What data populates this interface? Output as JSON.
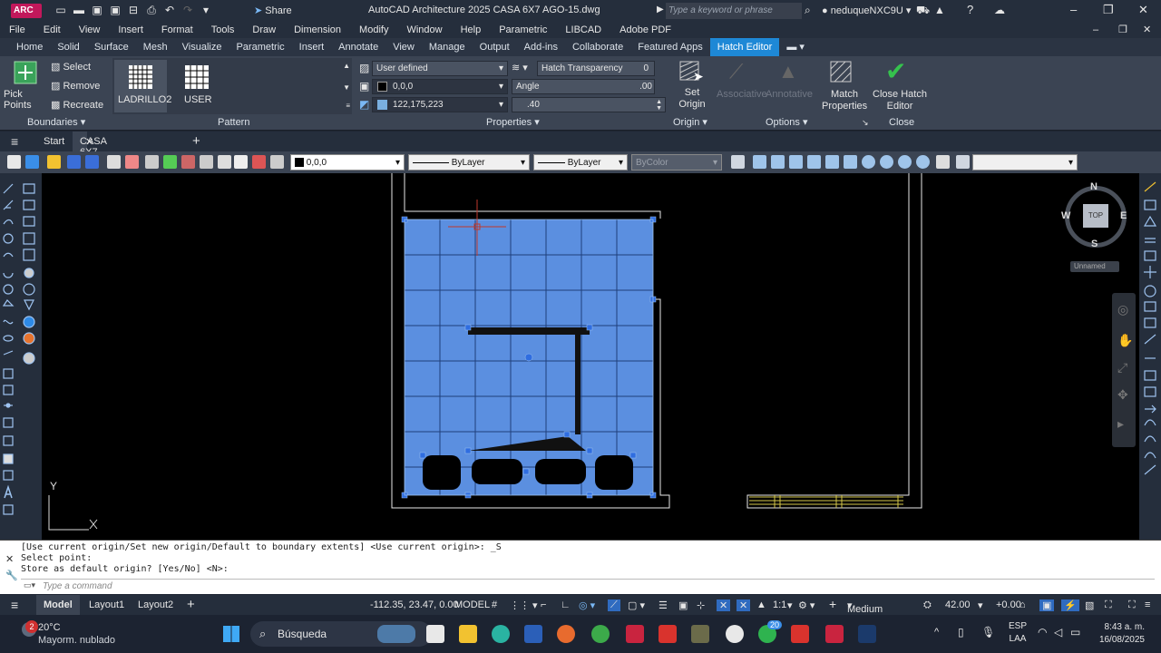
{
  "titlebar": {
    "app_logo": "ARC",
    "share_label": "Share",
    "window_title": "AutoCAD Architecture 2025   CASA 6X7 AGO-15.dwg",
    "search_placeholder": "Type a keyword or phrase",
    "username": "neduqueNXC9U"
  },
  "menubar": [
    "File",
    "Edit",
    "View",
    "Insert",
    "Format",
    "Tools",
    "Draw",
    "Dimension",
    "Modify",
    "Window",
    "Help",
    "Parametric",
    "LIBCAD",
    "Adobe PDF"
  ],
  "ribbon_tabs": [
    "Home",
    "Solid",
    "Surface",
    "Mesh",
    "Visualize",
    "Parametric",
    "Insert",
    "Annotate",
    "View",
    "Manage",
    "Output",
    "Add-ins",
    "Collaborate",
    "Featured Apps",
    "Hatch Editor"
  ],
  "ribbon": {
    "boundaries": {
      "pick_points": "Pick Points",
      "select": "Select",
      "remove": "Remove",
      "recreate": "Recreate",
      "panel_label": "Boundaries"
    },
    "pattern": {
      "items": [
        "LADRILLO2",
        "USER"
      ],
      "panel_label": "Pattern"
    },
    "properties": {
      "type": "User defined",
      "color": "0,0,0",
      "bg_color": "122,175,223",
      "transparency_label": "Hatch Transparency",
      "transparency_value": "0",
      "angle_label": "Angle",
      "angle_value": ".00",
      "scale_value": ".40",
      "panel_label": "Properties"
    },
    "origin": {
      "set_origin": "Set Origin",
      "panel_label": "Origin"
    },
    "options": {
      "associative": "Associative",
      "annotative": "Annotative",
      "match_properties": "Match Properties",
      "panel_label": "Options"
    },
    "close": {
      "close_label": "Close Hatch Editor",
      "panel_label": "Close"
    }
  },
  "filetabs": {
    "start": "Start",
    "active_file": "CASA 6X7 AGO-15*"
  },
  "prop_toolbar": {
    "color": "0,0,0",
    "linetype": "ByLayer",
    "lineweight": "ByLayer",
    "plotstyle": "ByColor"
  },
  "viewcube": {
    "north": "N",
    "south": "S",
    "east": "E",
    "west": "W",
    "face": "TOP",
    "ucs_name": "Unnamed"
  },
  "ucs": {
    "y_label": "Y",
    "x_label": "X"
  },
  "command": {
    "line1": "[Use current origin/Set new origin/Default to boundary extents] <Use current origin>: _S",
    "line2": "Select point:",
    "line3": "Store as default origin? [Yes/No] <N>:",
    "placeholder": "Type a command"
  },
  "statusbar": {
    "model_tab": "Model",
    "layout1": "Layout1",
    "layout2": "Layout2",
    "coords": "-112.35, 23.47, 0.00",
    "space": "MODEL",
    "scale": "1:1",
    "detail": "Medium Detail",
    "elevation": "42.00",
    "offset": "+0.00"
  },
  "taskbar": {
    "temperature": "20°C",
    "weather": "Mayorm. nublado",
    "weather_badge": "2",
    "search": "Búsqueda",
    "whatsapp_badge": "20",
    "lang1": "ESP",
    "lang2": "LAA",
    "time": "8:43 a. m.",
    "date": "16/08/2025"
  },
  "colors": {
    "hatch_fill": "#5b8fe0",
    "accent": "#1e88d6"
  }
}
